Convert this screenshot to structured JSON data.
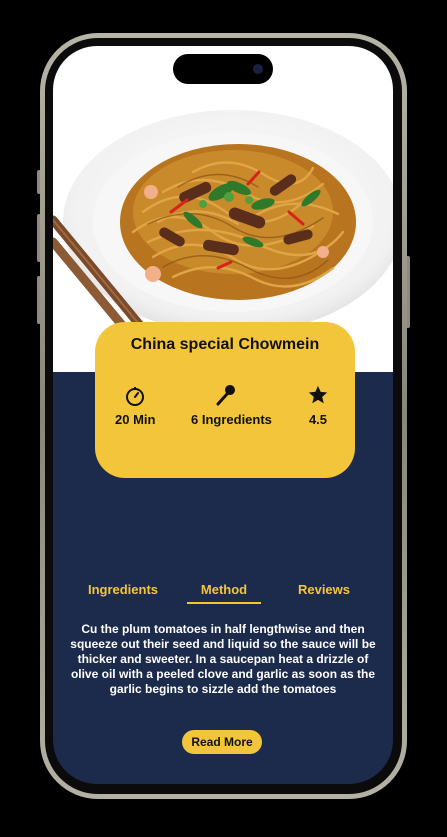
{
  "recipe": {
    "title": "China special Chowmein",
    "stats": {
      "time": "20 Min",
      "ingredients": "6 Ingredients",
      "rating": "4.5"
    }
  },
  "tabs": [
    {
      "label": "Ingredients",
      "active": false
    },
    {
      "label": "Method",
      "active": true
    },
    {
      "label": "Reviews",
      "active": false
    }
  ],
  "method_text": "Cu the plum tomatoes in half lengthwise and then squeeze out their seed and liquid so the sauce will be thicker and sweeter. In a saucepan heat a drizzle of olive oil with a peeled clove and garlic as soon as the garlic begins to sizzle add the tomatoes",
  "read_more_label": "Read More",
  "colors": {
    "accent": "#f2c53a",
    "background": "#1c2b4c",
    "text_light": "#ffffff"
  },
  "icons": {
    "time": "timer-icon",
    "ingredients": "spoon-icon",
    "rating": "star-icon"
  }
}
